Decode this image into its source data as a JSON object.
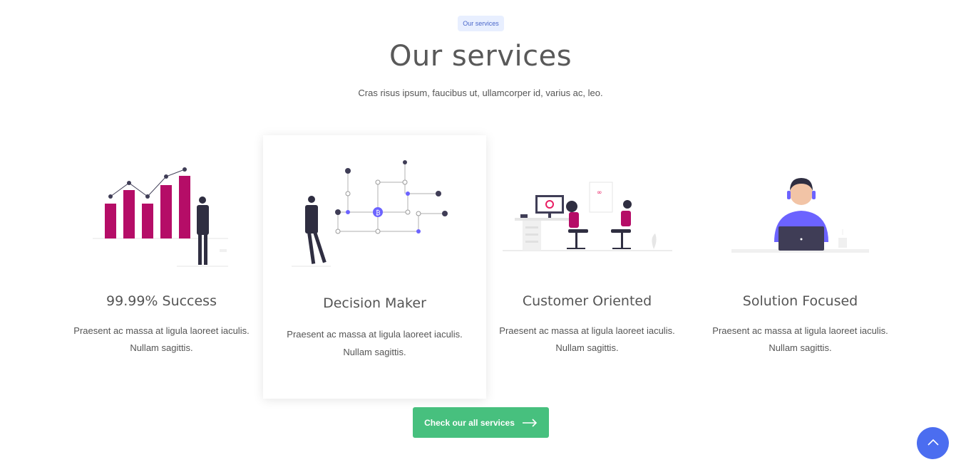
{
  "header": {
    "badge": "Our services",
    "title": "Our services",
    "subtitle": "Cras risus ipsum, faucibus ut, ullamcorper id, varius ac, leo."
  },
  "services": [
    {
      "title": "99.99% Success",
      "desc_line1": "Praesent ac massa at ligula laoreet iaculis.",
      "desc_line2": "Nullam sagittis."
    },
    {
      "title": "Decision Maker",
      "desc_line1": "Praesent ac massa at ligula laoreet iaculis.",
      "desc_line2": "Nullam sagittis."
    },
    {
      "title": "Customer Oriented",
      "desc_line1": "Praesent ac massa at ligula laoreet iaculis.",
      "desc_line2": "Nullam sagittis."
    },
    {
      "title": "Solution Focused",
      "desc_line1": "Praesent ac massa at ligula laoreet iaculis.",
      "desc_line2": "Nullam sagittis."
    }
  ],
  "cta": {
    "label": "Check our all services",
    "icon": "arrow-right-icon"
  },
  "scroll_top": {
    "icon": "chevron-up-icon"
  },
  "colors": {
    "accent_green": "#47c07e",
    "accent_blue": "#4b6df0",
    "chart_magenta": "#b50d67",
    "network_purple": "#6c63ff"
  }
}
